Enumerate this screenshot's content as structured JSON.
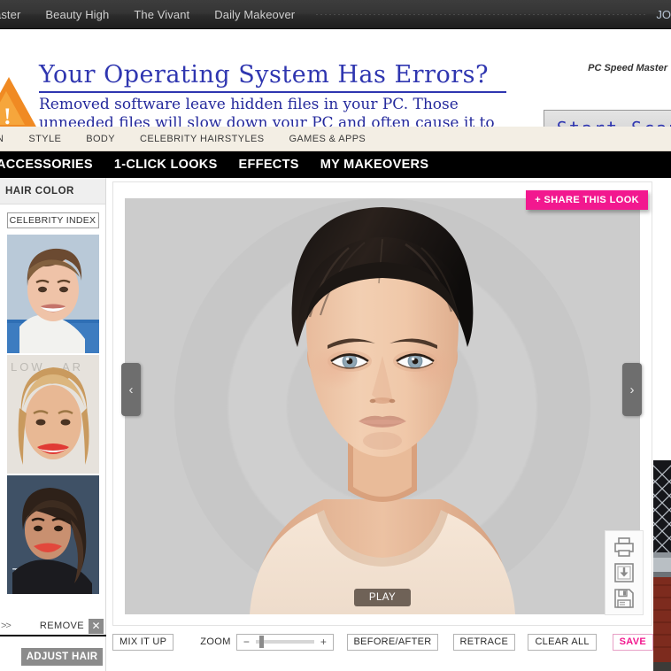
{
  "partner_bar": {
    "links": [
      "aster",
      "Beauty High",
      "The Vivant",
      "Daily Makeover"
    ],
    "right_text": "JO"
  },
  "advert": {
    "headline": "Your Operating System Has Errors?",
    "body": "Removed software leave hidden files in your PC. Those unneeded files will slow down your PC and often cause it to crash. You need to Clean Your Registry Now!",
    "brand": "PC Speed Master",
    "cta_label": "Start Scan",
    "warning_glyph": "!",
    "accent_color": "#2f36b0",
    "warning_color": "#f08a23"
  },
  "site_nav": {
    "items": [
      "N",
      "STYLE",
      "BODY",
      "CELEBRITY HAIRSTYLES",
      "GAMES & APPS"
    ]
  },
  "app_nav": {
    "items": [
      "ACCESSORIES",
      "1-CLICK LOOKS",
      "EFFECTS",
      "MY MAKEOVERS"
    ]
  },
  "sidebar": {
    "title": "HAIR COLOR",
    "celebrity_index_label": "CELEBRITY INDEX",
    "thumbnails": [
      {
        "name": "celebrity-thumb-1",
        "alt": "short brown pixie hair celebrity"
      },
      {
        "name": "celebrity-thumb-2",
        "alt": "long blonde hair celebrity"
      },
      {
        "name": "celebrity-thumb-3",
        "alt": "dark wavy hair celebrity"
      }
    ],
    "remove_chevrons": ">>",
    "remove_label": "REMOVE",
    "remove_x_glyph": "✕",
    "adjust_hair_label": "ADJUST HAIR"
  },
  "canvas": {
    "share_label": "+ SHARE THIS LOOK",
    "share_color": "#f2188f",
    "prev_glyph": "‹",
    "next_glyph": "›",
    "play_label": "PLAY",
    "background_color": "#cccccc",
    "model_alt": "female model front-facing portrait with dark pulled-back hair"
  },
  "tool_strip": {
    "icons": [
      {
        "name": "print-icon",
        "label": "Print"
      },
      {
        "name": "download-icon",
        "label": "Download"
      },
      {
        "name": "save-disk-icon",
        "label": "Save"
      }
    ]
  },
  "bottom_toolbar": {
    "mix_it_up_label": "MIX IT UP",
    "zoom_label": "ZOOM",
    "zoom_minus": "−",
    "zoom_plus": "+",
    "zoom_value": 5,
    "before_after_label": "BEFORE/AFTER",
    "retrace_label": "RETRACE",
    "clear_all_label": "CLEAR ALL",
    "save_label": "SAVE"
  },
  "right_edge": {
    "alt": "partially visible photo of chain link fence over red brick wall"
  }
}
